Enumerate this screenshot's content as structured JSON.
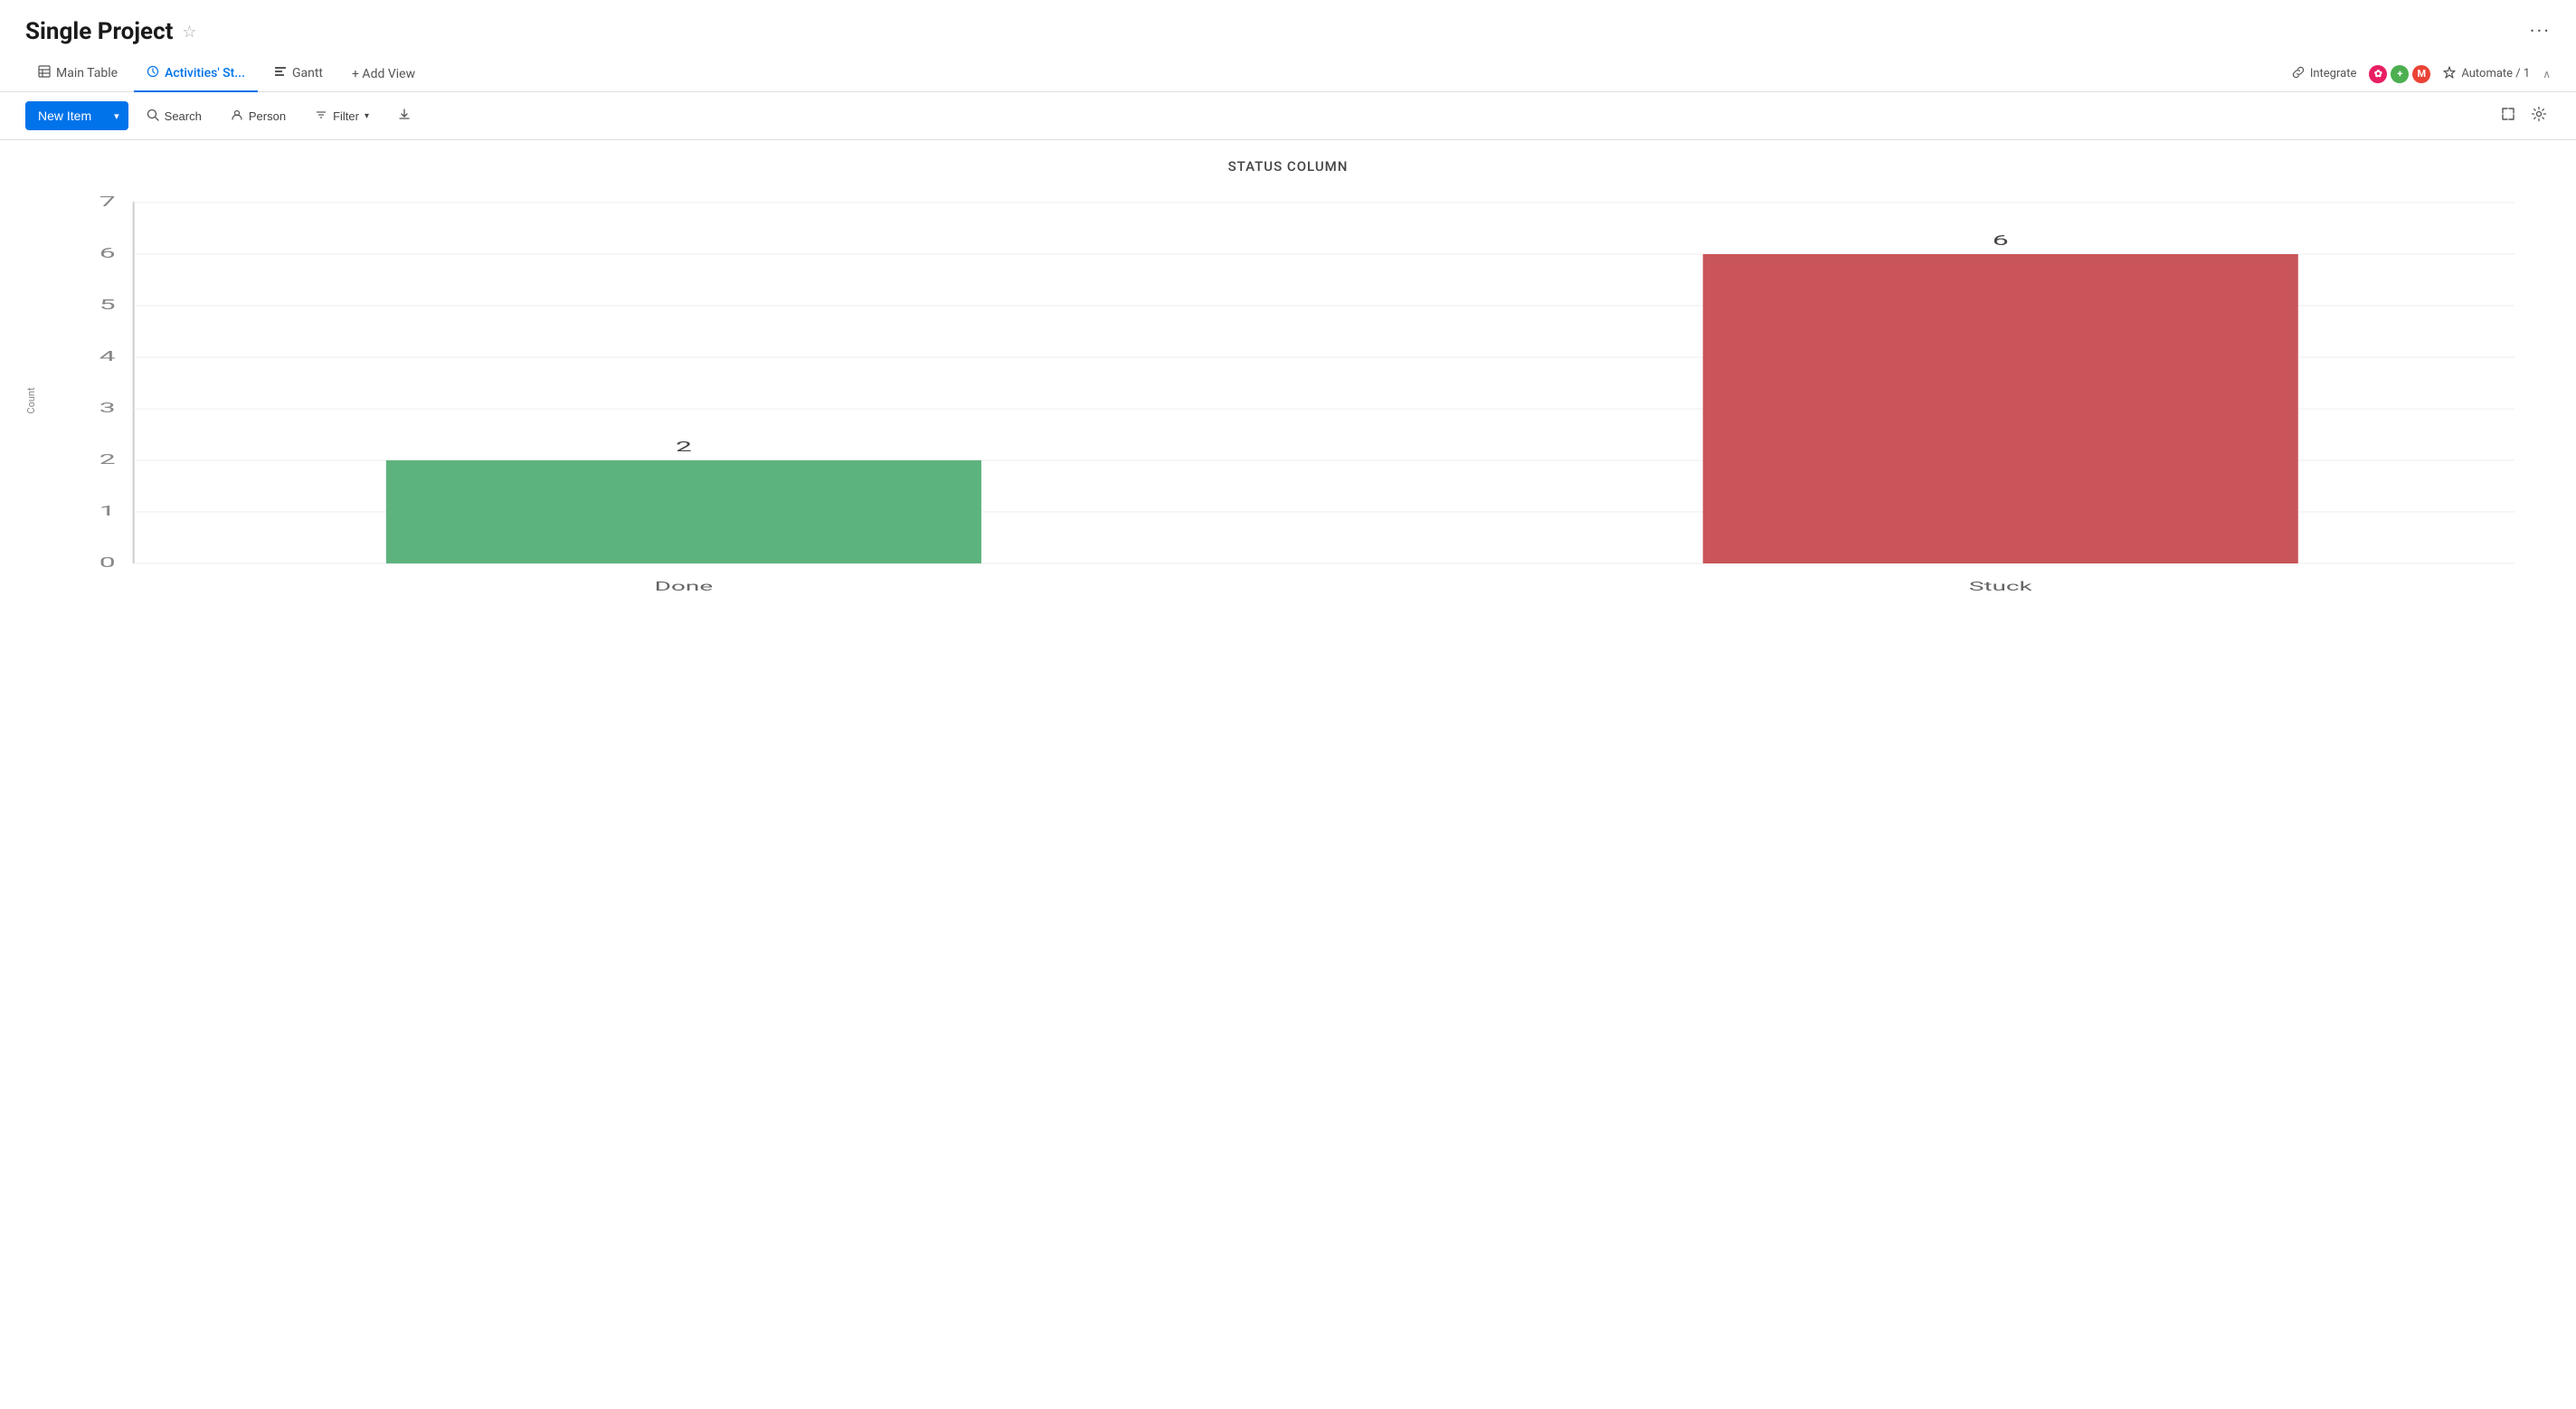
{
  "header": {
    "title": "Single Project",
    "more_icon": "⋯"
  },
  "tabs": {
    "items": [
      {
        "id": "main-table",
        "label": "Main Table",
        "icon": "⊞",
        "active": false
      },
      {
        "id": "activities",
        "label": "Activities' St...",
        "icon": "◷",
        "active": true
      },
      {
        "id": "gantt",
        "label": "Gantt",
        "icon": "▤",
        "active": false
      }
    ],
    "add_view": "+ Add View",
    "integrate_label": "Integrate",
    "automate_label": "Automate / 1"
  },
  "toolbar": {
    "new_item_label": "New Item",
    "search_label": "Search",
    "person_label": "Person",
    "filter_label": "Filter",
    "download_icon": "⬇"
  },
  "chart": {
    "title": "STATUS COLUMN",
    "y_axis_label": "Count",
    "y_max": 7,
    "bars": [
      {
        "label": "Done",
        "value": 2,
        "color": "#5db37e",
        "max": 7
      },
      {
        "label": "Stuck",
        "value": 6,
        "color": "#c9555a",
        "max": 7
      }
    ],
    "y_ticks": [
      0,
      1,
      2,
      3,
      4,
      5,
      6,
      7
    ]
  },
  "colors": {
    "primary": "#0073ea",
    "done_bar": "#5db37e",
    "stuck_bar": "#c9555a"
  }
}
